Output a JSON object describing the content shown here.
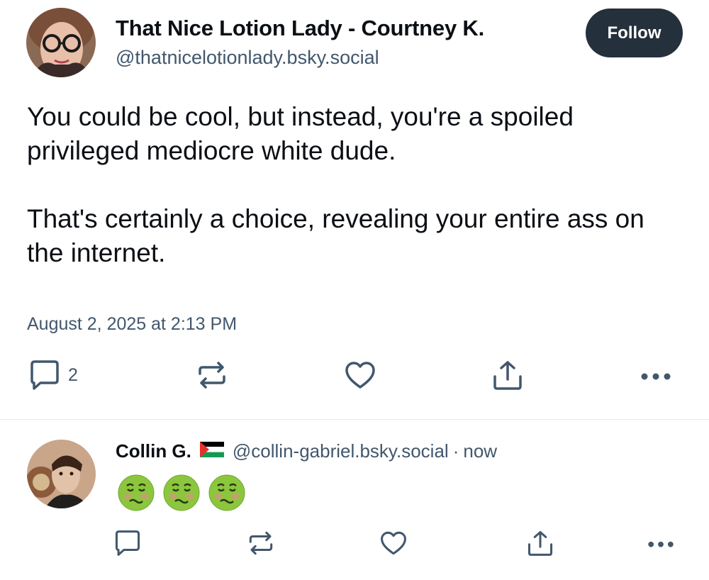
{
  "post": {
    "display_name": "That Nice Lotion Lady - Courtney K.",
    "handle": "@thatnicelotionlady.bsky.social",
    "follow_label": "Follow",
    "paragraphs": [
      "You could be cool, but instead, you're a spoiled privileged mediocre white dude.",
      "That's certainly a choice, revealing your entire ass on the internet."
    ],
    "timestamp": "August 2, 2025 at 2:13 PM",
    "actions": {
      "reply_icon": "comment-icon",
      "reply_count": "2",
      "repost_icon": "repost-icon",
      "like_icon": "heart-icon",
      "share_icon": "share-icon",
      "more_icon": "more-icon"
    }
  },
  "reply": {
    "display_name": "Collin G.",
    "flag_icon": "palestine-flag-icon",
    "handle": "@collin-gabriel.bsky.social",
    "separator": "·",
    "time": "now",
    "emoji": [
      "nauseated-face-emoji",
      "nauseated-face-emoji",
      "nauseated-face-emoji"
    ]
  },
  "colors": {
    "text": "#0b0f14",
    "muted": "#42576c",
    "follow_bg": "#25303d",
    "divider": "#e3e8ec"
  }
}
